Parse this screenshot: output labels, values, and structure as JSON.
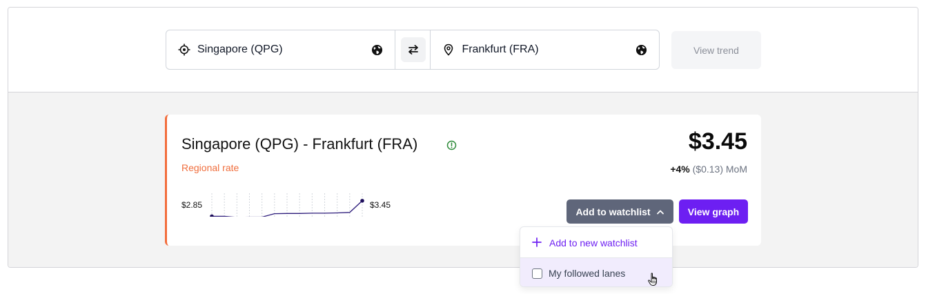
{
  "search": {
    "origin": "Singapore (QPG)",
    "destination": "Frankfurt (FRA)",
    "view_trend_label": "View trend"
  },
  "card": {
    "title": "Singapore (QPG) - Frankfurt (FRA)",
    "subtitle": "Regional rate",
    "price": "$3.45",
    "change_pct": "+4%",
    "change_abs": "($0.13) MoM",
    "spark_start": "$2.85",
    "spark_end": "$3.45",
    "watchlist_label": "Add to watchlist",
    "view_graph_label": "View graph"
  },
  "dropdown": {
    "add_new_label": "Add to new watchlist",
    "items": [
      {
        "label": "My followed lanes",
        "checked": false
      }
    ]
  },
  "chart_data": {
    "type": "line",
    "values": [
      2.85,
      2.85,
      2.81,
      2.82,
      2.82,
      2.95,
      2.96,
      2.96,
      2.97,
      2.97,
      2.98,
      3.0,
      3.45
    ],
    "ylim": [
      2.7,
      3.5
    ]
  },
  "colors": {
    "accent": "#6d1ff2",
    "rate_orange": "#f26b3a",
    "watch_btn": "#5f667a",
    "info_green": "#2e8b3a"
  }
}
